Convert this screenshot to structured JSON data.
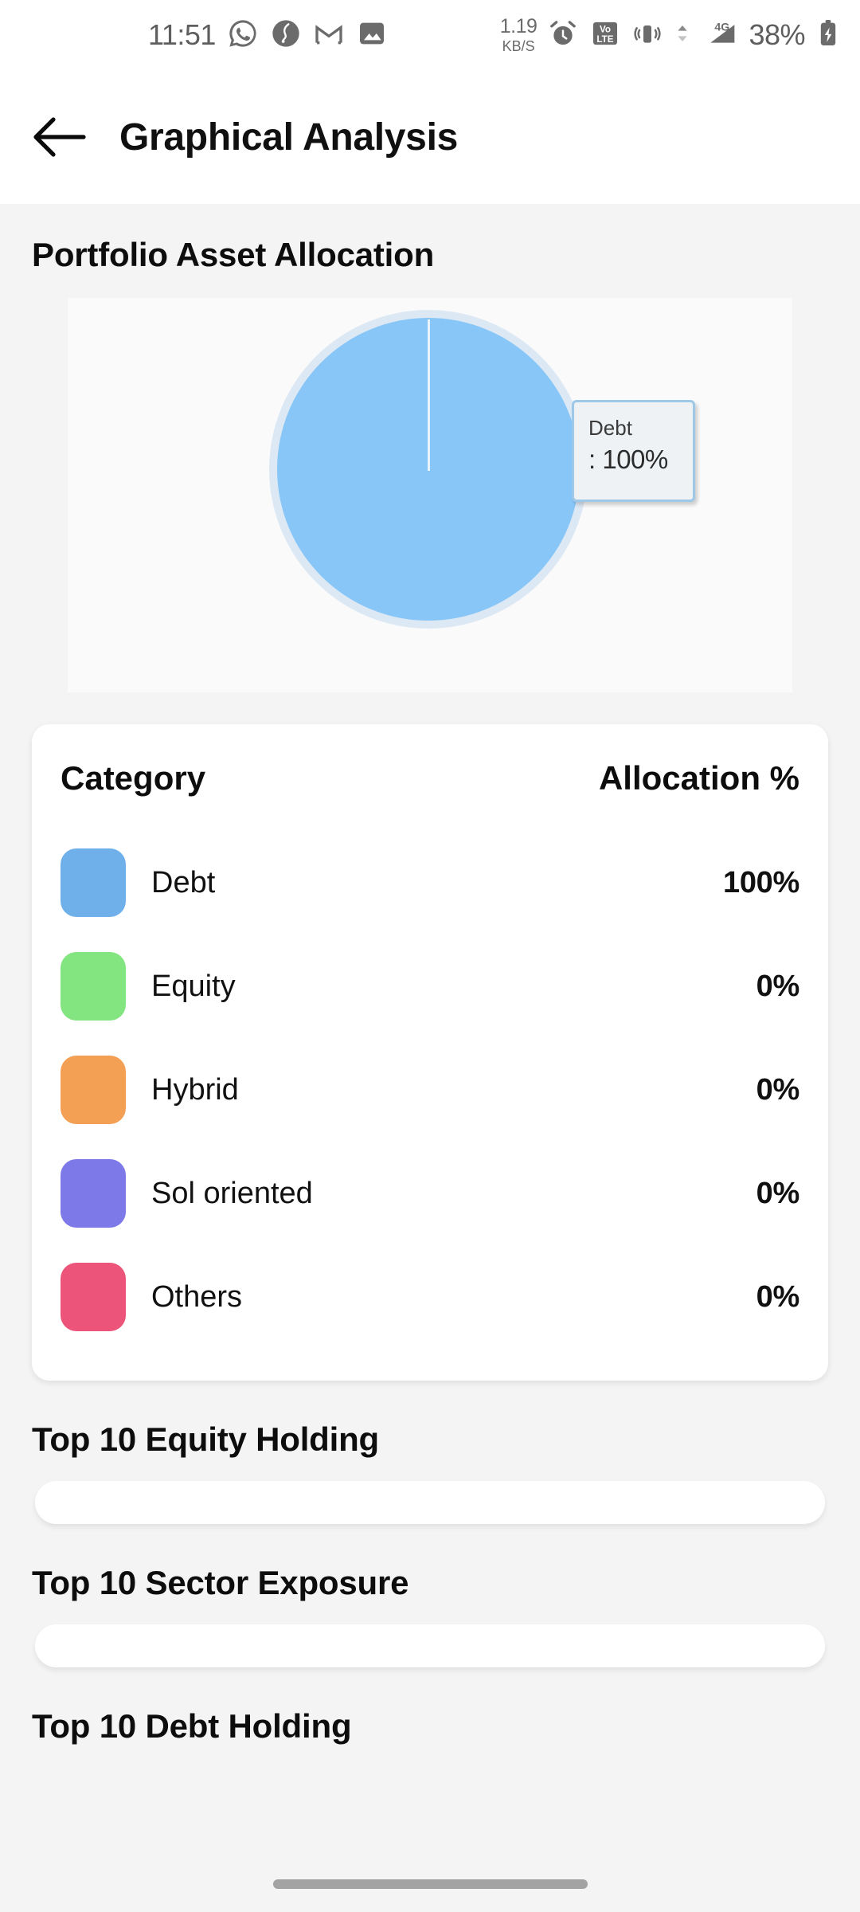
{
  "status_bar": {
    "time": "11:51",
    "network_speed_value": "1.19",
    "network_speed_unit": "KB/S",
    "battery_percent": "38%",
    "network_type": "4G",
    "volte_line1": "Vo",
    "volte_line2": "LTE",
    "icons": [
      "whatsapp-icon",
      "app-circle-icon",
      "gmail-icon",
      "gallery-icon",
      "alarm-icon",
      "volte-icon",
      "vibrate-icon",
      "data-arrows-icon",
      "signal-icon",
      "battery-charging-icon"
    ]
  },
  "app_bar": {
    "back_label": "back-arrow",
    "title": "Graphical Analysis"
  },
  "portfolio": {
    "section_title": "Portfolio Asset Allocation",
    "tooltip": {
      "label": "Debt",
      "value": ": 100%"
    }
  },
  "allocation_table": {
    "header": {
      "category": "Category",
      "allocation": "Allocation %"
    },
    "rows": [
      {
        "label": "Debt",
        "value": "100%",
        "color": "#6fb0ea"
      },
      {
        "label": "Equity",
        "value": "0%",
        "color": "#83e57f"
      },
      {
        "label": "Hybrid",
        "value": "0%",
        "color": "#f3a055"
      },
      {
        "label": "Sol oriented",
        "value": "0%",
        "color": "#7d79e8"
      },
      {
        "label": "Others",
        "value": "0%",
        "color": "#ec5579"
      }
    ]
  },
  "sections": [
    {
      "title": "Top 10 Equity Holding"
    },
    {
      "title": "Top 10 Sector Exposure"
    },
    {
      "title": "Top 10 Debt Holding"
    }
  ],
  "chart_data": {
    "type": "pie",
    "title": "Portfolio Asset Allocation",
    "categories": [
      "Debt",
      "Equity",
      "Hybrid",
      "Sol oriented",
      "Others"
    ],
    "values": [
      100,
      0,
      0,
      0,
      0
    ],
    "unit": "%",
    "colors": [
      "#87c6f7",
      "#83e57f",
      "#f3a055",
      "#7d79e8",
      "#ec5579"
    ],
    "highlight_color": "#dce9f5",
    "selected_slice": "Debt",
    "legend_position": "below-as-table",
    "annotation": "Debt : 100%"
  }
}
